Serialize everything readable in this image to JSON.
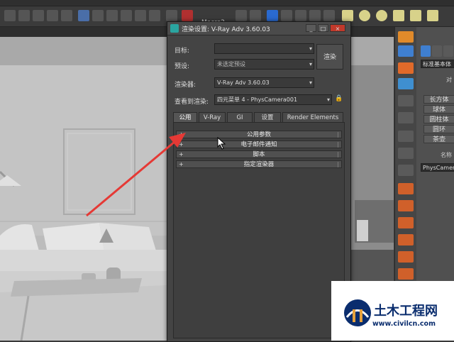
{
  "toolbar": {
    "macro_label": "Macro2"
  },
  "dialog": {
    "title": "渲染设置: V-Ray Adv 3.60.03",
    "window_buttons": [
      "_",
      "□",
      "×"
    ],
    "target_label": "目标:",
    "target_value": "",
    "preset_label": "预设:",
    "preset_value": "未选定预设",
    "renderer_label": "渲染器:",
    "renderer_value": "V-Ray Adv 3.60.03",
    "view_label": "查看到渲染:",
    "view_value": "四元菜单 4 - PhysCamera001",
    "render_button": "渲染",
    "tabs": [
      {
        "label": "公用",
        "active": true
      },
      {
        "label": "V-Ray",
        "active": false
      },
      {
        "label": "GI",
        "active": false
      },
      {
        "label": "设置",
        "active": false
      },
      {
        "label": "Render Elements",
        "active": false
      }
    ],
    "rollouts": [
      {
        "label": "公用参数"
      },
      {
        "label": "电子邮件通知"
      },
      {
        "label": "脚本"
      },
      {
        "label": "指定渲染器"
      }
    ]
  },
  "command_panel": {
    "category_dropdown": "标准基本体",
    "section_header_1": "对",
    "objects": [
      "长方体",
      "球体",
      "圆柱体",
      "圆环",
      "茶壶"
    ],
    "section_header_2": "名称",
    "name_field": "PhysCamera"
  },
  "watermark": {
    "name": "土木工程网",
    "url": "www.civilcn.com"
  },
  "colors": {
    "dialog_bg": "#444444",
    "arrow": "#e53935",
    "brand_blue": "#0a2d6e",
    "accent_teal": "#2aa5a0"
  }
}
